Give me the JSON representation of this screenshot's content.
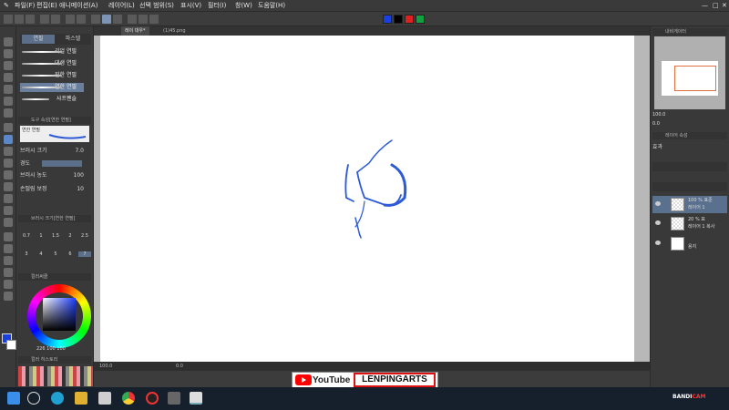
{
  "menu": [
    "파일(F)",
    "편집(E)",
    "애니메이션(A)",
    "레이어(L)",
    "선택 범위(S)",
    "표시(V)",
    "필터(I)",
    "창(W)",
    "도움말(H)"
  ],
  "colors": {
    "current": "#1a3fe0",
    "accent": "#5b88c8",
    "stroke": "#2d5bd8"
  },
  "tabs": [
    "레이 대우*",
    "(1)45.png"
  ],
  "subtool": {
    "header_left": "연필",
    "header_right": "파스텔",
    "brushes": [
      "리얼 연필",
      "데생 연필",
      "진한 연필",
      "연한 연필",
      "샤프펜슬"
    ],
    "selected_brush_index": 3
  },
  "tool_property": {
    "title": "도구 속성[연한 연필]",
    "preview_label": "연한 연필",
    "brush_size_label": "브러시 크기",
    "brush_size_value": "7.0",
    "hardness_label": "경도",
    "brush_density_label": "브러시 농도",
    "brush_density_value": "100",
    "stabilization_label": "손떨림 보정",
    "stabilization_value": "10"
  },
  "brush_size_panel": {
    "title": "브러시 크기[연한 연필]",
    "sizes_row1": [
      "0.7",
      "1",
      "1.5",
      "2",
      "2.5"
    ],
    "sizes_row2": [
      "3",
      "4",
      "5",
      "6",
      "7"
    ]
  },
  "color_panel": {
    "title": "컬러써클",
    "readout": "226 100 100"
  },
  "palette_title": "컬러 히스토리",
  "status": {
    "zoom": "100.0",
    "angle": "0.0"
  },
  "navigator": {
    "title": "내비게이터",
    "zoom": "100.0",
    "angle": "0.0"
  },
  "layer_property": {
    "title": "레이어 속성",
    "effect_label": "효과"
  },
  "layers": [
    {
      "name": "100 % 표준",
      "sub": "레이어 1",
      "selected": true
    },
    {
      "name": "20 % 표",
      "sub": "레이어 1 복사",
      "selected": false
    },
    {
      "name": "",
      "sub": "용지",
      "selected": false
    }
  ],
  "banner": {
    "youtube": "YouTube",
    "channel": "LENPINGARTS"
  },
  "bandicam": {
    "left": "BANDI",
    "right": "CAM"
  }
}
